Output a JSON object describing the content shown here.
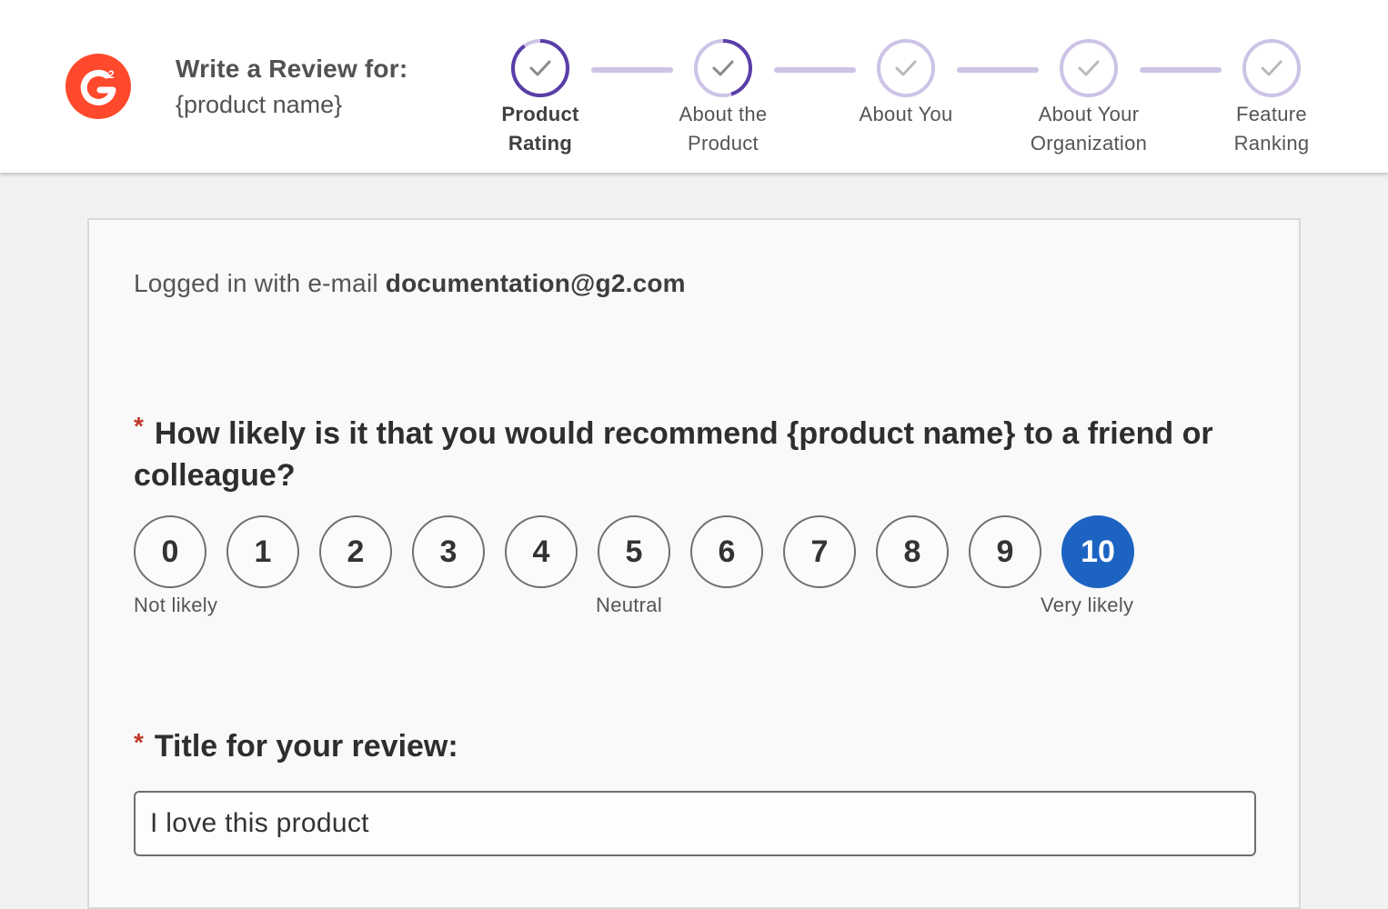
{
  "header": {
    "logo_text": "2",
    "title": "Write a Review for:",
    "product": "{product name}",
    "brand_color": "#ff492c"
  },
  "steps": [
    {
      "label_line1": "Product",
      "label_line2": "Rating",
      "state": "active",
      "progress": 0.9
    },
    {
      "label_line1": "About the",
      "label_line2": "Product",
      "state": "in-progress",
      "progress": 0.45
    },
    {
      "label_line1": "About You",
      "label_line2": "",
      "state": "pending",
      "progress": 0
    },
    {
      "label_line1": "About Your",
      "label_line2": "Organization",
      "state": "pending",
      "progress": 0
    },
    {
      "label_line1": "Feature",
      "label_line2": "Ranking",
      "state": "pending",
      "progress": 0
    }
  ],
  "account": {
    "prefix": "Logged in with e-mail ",
    "email": "documentation@g2.com"
  },
  "nps_question": {
    "required_mark": "*",
    "text": "How likely is it that you would recommend {product name} to a friend or colleague?",
    "options": [
      "0",
      "1",
      "2",
      "3",
      "4",
      "5",
      "6",
      "7",
      "8",
      "9",
      "10"
    ],
    "selected": "10",
    "label_low": "Not likely",
    "label_mid": "Neutral",
    "label_high": "Very likely",
    "selected_color": "#1d64c2"
  },
  "review_title": {
    "required_mark": "*",
    "label": "Title for your review:",
    "value": "I love this product"
  },
  "colors": {
    "step_accent": "#5a3ea8",
    "step_track": "#cdc3e6"
  }
}
